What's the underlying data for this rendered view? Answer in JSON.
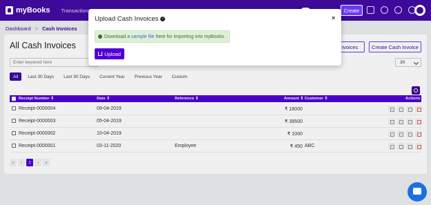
{
  "app": {
    "name": "myBooks"
  },
  "nav": {
    "items": [
      "Transactions"
    ]
  },
  "header": {
    "create_label": "Create"
  },
  "breadcrumb": {
    "home": "Dashboard",
    "sep": ">",
    "current": "Cash Invoices"
  },
  "page": {
    "title": "All Cash Invoices",
    "btn_invoices": "Invoices",
    "btn_create": "Create Cash Invoice",
    "search_placeholder": "Enter keyword here",
    "page_size": "30"
  },
  "filters": [
    "All",
    "Last 30 Days",
    "Last 90 Days",
    "Current Year",
    "Previous Year",
    "Custom"
  ],
  "table": {
    "headers": {
      "receipt": "Receipt Number ⇕",
      "date": "Date ⇕",
      "reference": "Reference ⇕",
      "amount": "Amount ⇕",
      "customer": "Customer ⇕",
      "actions": "Actions"
    },
    "rows": [
      {
        "receipt": "Receipt-0000004",
        "date": "09-04-2019",
        "reference": "",
        "amount": "₹ 18000",
        "customer": ""
      },
      {
        "receipt": "Receipt-0000003",
        "date": "05-04-2019",
        "reference": "",
        "amount": "₹ 39500",
        "customer": ""
      },
      {
        "receipt": "Receipt-0000002",
        "date": "10-04-2019",
        "reference": "",
        "amount": "₹ 1000",
        "customer": ""
      },
      {
        "receipt": "Receipt-0000001",
        "date": "03-11-2020",
        "reference": "Employee",
        "amount": "₹ 450",
        "customer": "ABC"
      }
    ]
  },
  "pager": {
    "first": "«",
    "prev": "‹",
    "page": "1",
    "next": "›",
    "last": "»"
  },
  "modal": {
    "title": "Upload Cash Invoices",
    "close": "×",
    "info_prefix": "Download a",
    "info_link": "sample file",
    "info_suffix": "here for importing into myBooks.",
    "upload_label": "Upload"
  }
}
